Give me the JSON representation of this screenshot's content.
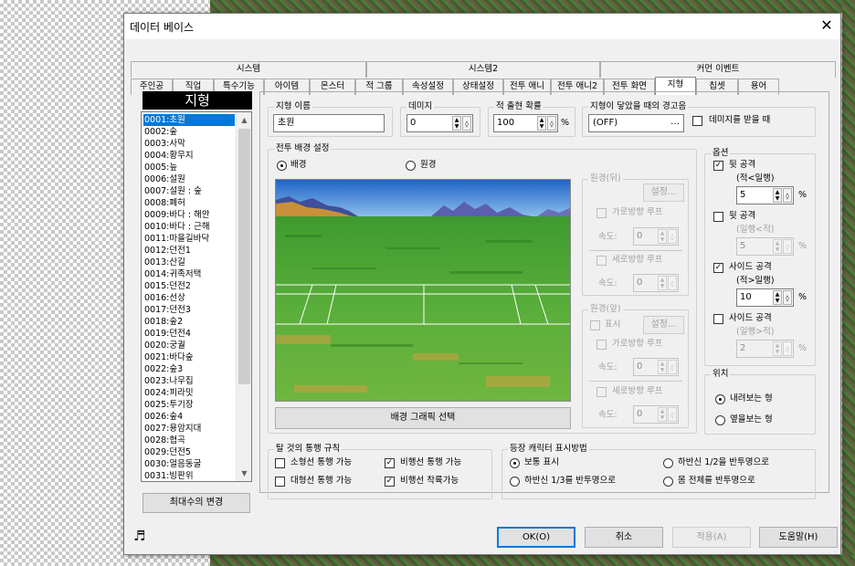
{
  "window_title": "데이터 베이스",
  "close_glyph": "✕",
  "tabs_row1": [
    "시스템",
    "시스템2",
    "커먼 이벤트"
  ],
  "tabs_row2": [
    "주인공",
    "직업",
    "특수기능",
    "아이템",
    "몬스터",
    "적 그룹",
    "속성설정",
    "상태설정",
    "전투 애니",
    "전투 애니2",
    "전투 화면",
    "지형",
    "칩셋",
    "용어"
  ],
  "active_tab": "지형",
  "list": {
    "header": "지형",
    "items": [
      "0001:초원",
      "0002:숲",
      "0003:사막",
      "0004:황무지",
      "0005:늪",
      "0006:설원",
      "0007:설원 : 숲",
      "0008:폐허",
      "0009:바다 : 해안",
      "0010:바다 : 근해",
      "0011:마을길바닥",
      "0012:던전1",
      "0013:산길",
      "0014:귀족저택",
      "0015:던전2",
      "0016:선상",
      "0017:던전3",
      "0018:숲2",
      "0019:던전4",
      "0020:궁궐",
      "0021:바다숲",
      "0022:숲3",
      "0023:나무집",
      "0024:피라밋",
      "0025:투기장",
      "0026:숲4",
      "0027:용암지대",
      "0028:협곡",
      "0029:던전5",
      "0030:얼음동굴",
      "0031:빙판위"
    ],
    "selected_index": 0,
    "max_button": "최대수의 변경"
  },
  "form": {
    "name_label": "지형 이름",
    "name_value": "초원",
    "damage_label": "데미지",
    "damage_value": "0",
    "encounter_label": "적 출현 확률",
    "encounter_value": "100",
    "encounter_unit": "%",
    "sound_label": "지형이 닿았을 때의 경고음",
    "sound_value": "(OFF)",
    "sound_btn": "…",
    "receive_damage_label": "데미지를 받을 때",
    "receive_damage_checked": false
  },
  "battle_bg": {
    "group_label": "전투 배경 설정",
    "radio_bg": "배경",
    "radio_far": "원경",
    "selected": "배경",
    "select_button": "배경 그래픽 선택",
    "far_back": {
      "label": "원경(뒤)",
      "set_button": "설정...",
      "horiz_label": "가로방향 루프",
      "vert_label": "세로방향 루프",
      "speed_label": "속도:",
      "horiz_speed": "0",
      "vert_speed": "0"
    },
    "far_front": {
      "label": "원경(앞)",
      "show_label": "표시",
      "set_button": "설정...",
      "horiz_label": "가로방향 루프",
      "vert_label": "세로방향 루프",
      "speed_label": "속도:",
      "horiz_speed": "0",
      "vert_speed": "0"
    }
  },
  "options": {
    "label": "옵션",
    "back_attack_label": "뒷 공격",
    "back_attack_sub": "(적<일행)",
    "back_attack_checked": true,
    "back_attack_value": "5",
    "back_attack2_label": "뒷 공격",
    "back_attack2_sub": "(일행<적)",
    "back_attack2_checked": false,
    "back_attack2_value": "5",
    "side_attack_label": "사이드 공격",
    "side_attack_sub": "(적>일행)",
    "side_attack_checked": true,
    "side_attack_value": "10",
    "side_attack2_label": "사이드 공격",
    "side_attack2_sub": "(일행>적)",
    "side_attack2_checked": false,
    "side_attack2_value": "2",
    "unit": "%"
  },
  "position": {
    "label": "위치",
    "opt1": "내려보는 형",
    "opt2": "옆을보는 형",
    "selected": "내려보는 형"
  },
  "vehicle": {
    "label": "탈 것의 통행 규칙",
    "small": "소형선 통행 가능",
    "large": "대형선 통행 가능",
    "airship": "비행선 통행 가능",
    "land": "비행선 착륙가능",
    "small_checked": false,
    "large_checked": false,
    "airship_checked": true,
    "land_checked": true
  },
  "display": {
    "label": "등장 캐릭터 표시방법",
    "opt1": "보통 표시",
    "opt2": "하반신 1/3를 반투명으로",
    "opt3": "하반신 1/2을 반투명으로",
    "opt4": "몸 전체를 반투명으로",
    "selected": "보통 표시"
  },
  "buttons": {
    "ok": "OK(O)",
    "cancel": "취소",
    "apply": "적용(A)",
    "help": "도움말(H)"
  },
  "icons": {
    "music": "♬",
    "check": "✓",
    "up": "▲",
    "down": "▼"
  }
}
